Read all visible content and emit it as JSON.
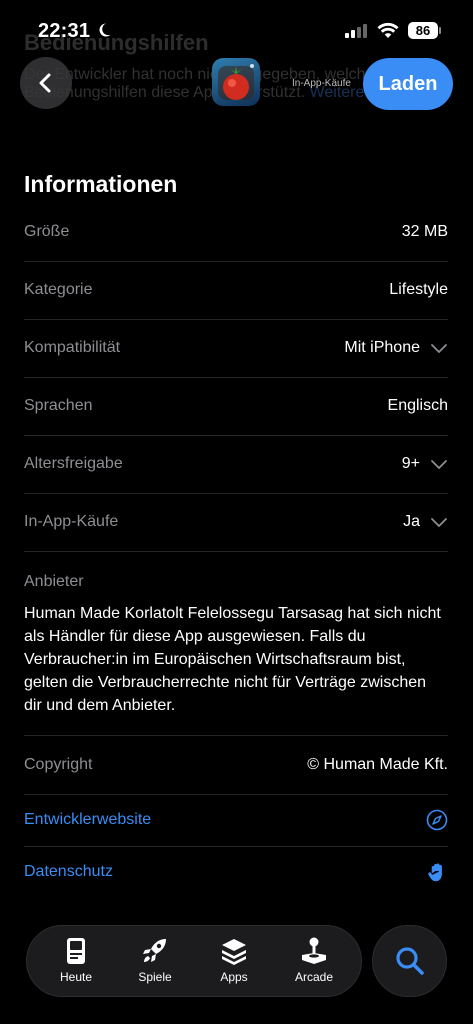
{
  "status_bar": {
    "time": "22:31",
    "battery": "86"
  },
  "background_text": {
    "title": "Bedienungshilfen",
    "line1": "Der Entwickler hat noch nicht angegeben, welche",
    "line2": "Bedienungshilfen diese App unterstützt.",
    "link": "Weitere Infos"
  },
  "header": {
    "iap_label": "In-App-Käufe",
    "get_label": "Laden"
  },
  "info": {
    "title": "Informationen",
    "rows": [
      {
        "key": "Größe",
        "value": "32 MB",
        "expandable": false
      },
      {
        "key": "Kategorie",
        "value": "Lifestyle",
        "expandable": false
      },
      {
        "key": "Kompatibilität",
        "value": "Mit iPhone",
        "expandable": true
      },
      {
        "key": "Sprachen",
        "value": "Englisch",
        "expandable": false
      },
      {
        "key": "Altersfreigabe",
        "value": "9+",
        "expandable": true
      },
      {
        "key": "In-App-Käufe",
        "value": "Ja",
        "expandable": true
      }
    ],
    "vendor": {
      "key": "Anbieter",
      "text": "Human Made Korlatolt Felelossegu Tarsasag hat sich nicht als Händler für diese App ausgewiesen. Falls du Verbraucher:in im Europäischen Wirtschaftsraum bist, gelten die Verbraucherrechte nicht für Verträge zwischen dir und dem Anbieter."
    },
    "copyright": {
      "key": "Copyright",
      "value": "© Human Made Kft."
    },
    "links": [
      {
        "label": "Entwicklerwebsite",
        "icon": "compass-icon"
      },
      {
        "label": "Datenschutz",
        "icon": "hand-icon"
      }
    ]
  },
  "tabbar": {
    "tabs": [
      {
        "label": "Heute",
        "icon": "today-icon"
      },
      {
        "label": "Spiele",
        "icon": "rocket-icon"
      },
      {
        "label": "Apps",
        "icon": "apps-stack-icon"
      },
      {
        "label": "Arcade",
        "icon": "joystick-icon"
      }
    ],
    "search_icon": "search-icon"
  },
  "colors": {
    "accent": "#3a8df5",
    "background": "#000000",
    "secondary_text": "#8e8e93"
  }
}
